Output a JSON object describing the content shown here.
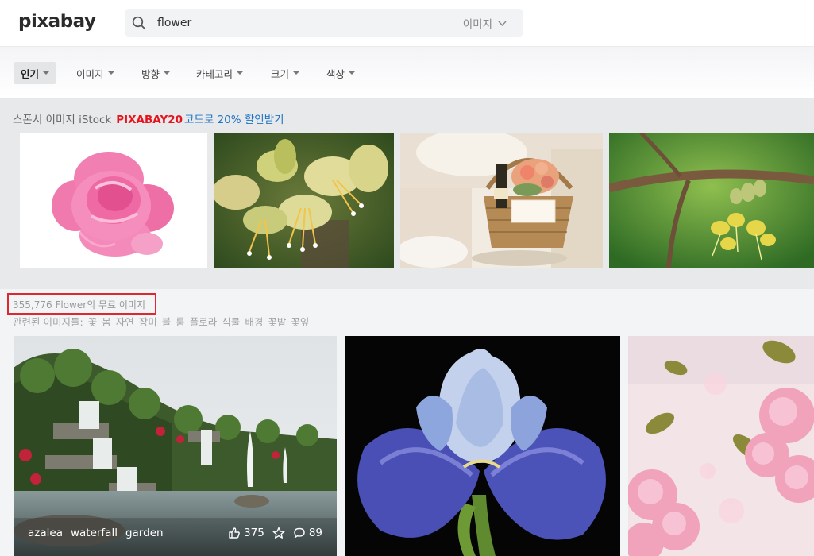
{
  "header": {
    "logo": "pixabay",
    "search": {
      "value": "flower",
      "type_label": "이미지"
    }
  },
  "filters": [
    {
      "label": "인기"
    },
    {
      "label": "이미지"
    },
    {
      "label": "방향"
    },
    {
      "label": "카테고리"
    },
    {
      "label": "크기"
    },
    {
      "label": "색상"
    }
  ],
  "sponsor": {
    "label_prefix": "스폰서 이미지 iStock",
    "code": "PIXABAY20",
    "promo": "코드로 20% 할인받기"
  },
  "results": {
    "count_text": "355,776 Flower의 무료 이미지",
    "related_label": "관련된 이미지들:",
    "related_tags": [
      "꽃",
      "봄",
      "자연",
      "장미",
      "블",
      "룸",
      "플로라",
      "식물",
      "배경",
      "꽃밭",
      "꽃잎"
    ],
    "first_image": {
      "tags": [
        "azalea",
        "waterfall",
        "garden"
      ],
      "likes": "375",
      "comments": "89"
    }
  },
  "colors": {
    "promo_code": "#e5141e",
    "promo_link": "#1d74c5",
    "highlight_box": "#e0262e"
  }
}
